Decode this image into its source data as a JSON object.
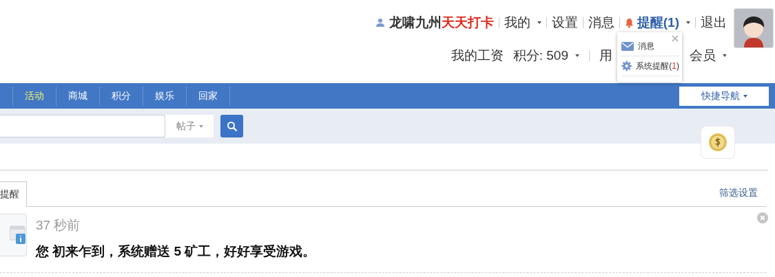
{
  "user_bar": {
    "username": "龙啸九州",
    "checkin": "天天打卡",
    "links": [
      {
        "label": "我的",
        "kind": "dropdown"
      },
      {
        "label": "设置",
        "kind": "link"
      },
      {
        "label": "消息",
        "kind": "link"
      },
      {
        "label": "提醒(1)",
        "kind": "alert"
      },
      {
        "label": "退出",
        "kind": "link"
      }
    ]
  },
  "info_bar": {
    "salary": "我的工资",
    "points": "积分: 509",
    "group_start": "用",
    "group_end": "会员"
  },
  "alert_menu": {
    "items": [
      {
        "kind": "mail",
        "label": "消息"
      },
      {
        "kind": "system",
        "label": "系统提醒(",
        "count": "1",
        "suffix": ")"
      }
    ]
  },
  "nav": {
    "items": [
      {
        "label": "活动",
        "selected": true
      },
      {
        "label": "商城",
        "selected": false
      },
      {
        "label": "积分",
        "selected": false
      },
      {
        "label": "娱乐",
        "selected": false
      },
      {
        "label": "回家",
        "selected": false
      }
    ],
    "quick_nav": "快捷导航"
  },
  "search": {
    "scope": "帖子"
  },
  "tabs": [
    {
      "label": "提醒",
      "selected": true
    }
  ],
  "filter_link": "筛选设置",
  "notifications": [
    {
      "time": "37 秒前",
      "message": "您 初来乍到，系统赠送 5 矿工，好好享受游戏。"
    }
  ]
}
